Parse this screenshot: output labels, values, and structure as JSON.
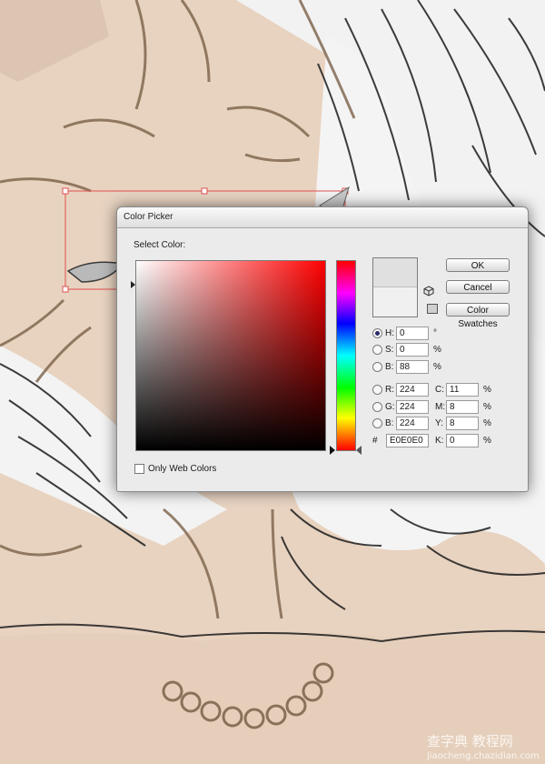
{
  "dialog": {
    "title": "Color Picker",
    "select_color_label": "Select Color:",
    "only_web_colors_label": "Only Web Colors",
    "buttons": {
      "ok": "OK",
      "cancel": "Cancel",
      "color_swatches": "Color Swatches"
    },
    "new_color_hex": "#e0e0e0",
    "current_color_hex": "#f0f0f0",
    "hsb": [
      {
        "label": "H:",
        "value": "0",
        "unit": "°",
        "selected": true
      },
      {
        "label": "S:",
        "value": "0",
        "unit": "%",
        "selected": false
      },
      {
        "label": "B:",
        "value": "88",
        "unit": "%",
        "selected": false
      }
    ],
    "rgb": [
      {
        "label": "R:",
        "value": "224"
      },
      {
        "label": "G:",
        "value": "224"
      },
      {
        "label": "B:",
        "value": "224"
      }
    ],
    "cmyk": [
      {
        "label": "C:",
        "value": "11",
        "unit": "%"
      },
      {
        "label": "M:",
        "value": "8",
        "unit": "%"
      },
      {
        "label": "Y:",
        "value": "8",
        "unit": "%"
      },
      {
        "label": "K:",
        "value": "0",
        "unit": "%"
      }
    ],
    "hex_label": "#",
    "hex_value": "E0E0E0"
  },
  "watermark": {
    "brand": "查字典 教程网",
    "url": "jiaocheng.chazidian.com"
  }
}
